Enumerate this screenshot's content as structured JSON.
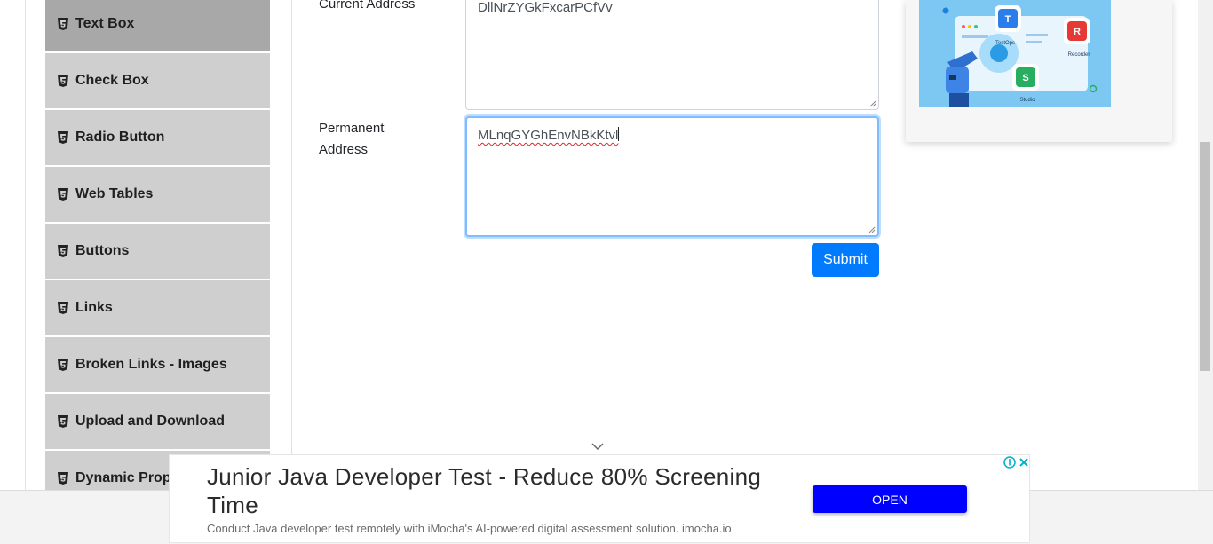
{
  "sidebar": {
    "items": [
      {
        "label": "Text Box",
        "icon": "html5-icon",
        "active": true
      },
      {
        "label": "Check Box",
        "icon": "html5-icon"
      },
      {
        "label": "Radio Button",
        "icon": "html5-icon"
      },
      {
        "label": "Web Tables",
        "icon": "html5-icon"
      },
      {
        "label": "Buttons",
        "icon": "html5-icon"
      },
      {
        "label": "Links",
        "icon": "html5-icon"
      },
      {
        "label": "Broken Links - Images",
        "icon": "html5-icon"
      },
      {
        "label": "Upload and Download",
        "icon": "html5-icon"
      },
      {
        "label": "Dynamic Properties",
        "icon": "html5-icon"
      }
    ]
  },
  "form": {
    "current_address_label": "Current Address",
    "current_address_value": "DllNrZYGkFxcarPCfVv",
    "permanent_address_label_line1": "Permanent",
    "permanent_address_label_line2": "Address",
    "permanent_address_value": "MLnqGYGhEnvNBkKtvl",
    "submit_label": "Submit"
  },
  "promo": {
    "labels": {
      "testops": "TestOps",
      "recorder": "Recorder",
      "studio": "Studio"
    }
  },
  "ad": {
    "headline": "Junior Java Developer Test - Reduce 80% Screening Time",
    "description": "Conduct Java developer test remotely with iMocha's AI-powered digital assessment solution. imocha.io",
    "cta": "OPEN",
    "cta_color": "#0000ff"
  },
  "colors": {
    "sidebar_bg": "#cfcfcf",
    "sidebar_active_bg": "#a8a8a8",
    "primary": "#007bff",
    "focus_border": "#80bdff"
  }
}
